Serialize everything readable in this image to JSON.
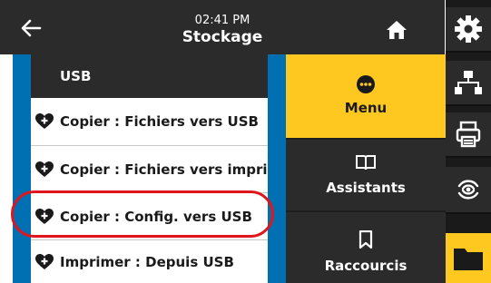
{
  "header": {
    "time": "02:41 PM",
    "title": "Stockage",
    "back_icon": "arrow-left-icon",
    "home_icon": "home-icon"
  },
  "list": {
    "header": "USB",
    "items": [
      {
        "label": "Copier : Fichiers vers USB",
        "icon": "heart-plus-icon"
      },
      {
        "label": "Copier : Fichiers vers imprim",
        "icon": "heart-plus-icon"
      },
      {
        "label": "Copier : Config. vers USB",
        "icon": "heart-plus-icon",
        "highlighted": true
      },
      {
        "label": "Imprimer : Depuis USB",
        "icon": "heart-plus-icon"
      }
    ]
  },
  "right_panel": {
    "menu": {
      "label": "Menu",
      "icon": "menu-dots-icon",
      "active": true
    },
    "assistants": {
      "label": "Assistants",
      "icon": "book-icon"
    },
    "shortcuts": {
      "label": "Raccourcis",
      "icon": "bookmark-icon"
    }
  },
  "side_nav": [
    {
      "icon": "gear-icon"
    },
    {
      "icon": "network-icon"
    },
    {
      "icon": "printer-icon"
    },
    {
      "icon": "wireless-icon"
    },
    {
      "icon": "folder-icon",
      "active": true
    }
  ],
  "colors": {
    "dark": "#2b2b2b",
    "accent_yellow": "#ffc820",
    "blue_rail": "#0070b3",
    "highlight_red": "#e0161c"
  }
}
